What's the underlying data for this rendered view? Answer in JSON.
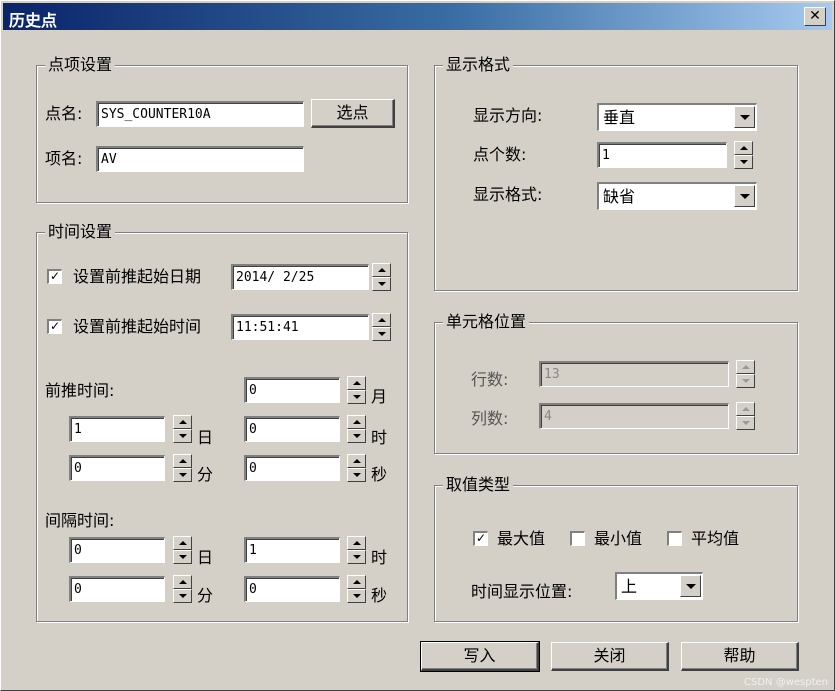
{
  "window": {
    "title": "历史点",
    "close_glyph": "✕"
  },
  "point_settings": {
    "title": "点项设置",
    "point_name_label": "点名:",
    "point_name_value": "SYS_COUNTER10A",
    "select_button": "选点",
    "item_name_label": "项名:",
    "item_name_value": "AV"
  },
  "time_settings": {
    "title": "时间设置",
    "start_date": {
      "checked": true,
      "label": "设置前推起始日期",
      "value": "2014/ 2/25"
    },
    "start_time": {
      "checked": true,
      "label": "设置前推起始时间",
      "value": "11:51:41"
    },
    "lookback": {
      "label": "前推时间:",
      "month": {
        "value": "0",
        "unit": "月"
      },
      "day": {
        "value": "1",
        "unit": "日"
      },
      "hour": {
        "value": "0",
        "unit": "时"
      },
      "minute": {
        "value": "0",
        "unit": "分"
      },
      "second": {
        "value": "0",
        "unit": "秒"
      }
    },
    "interval": {
      "label": "间隔时间:",
      "day": {
        "value": "0",
        "unit": "日"
      },
      "hour": {
        "value": "1",
        "unit": "时"
      },
      "minute": {
        "value": "0",
        "unit": "分"
      },
      "second": {
        "value": "0",
        "unit": "秒"
      }
    }
  },
  "display_format": {
    "title": "显示格式",
    "direction_label": "显示方向:",
    "direction_value": "垂直",
    "count_label": "点个数:",
    "count_value": "1",
    "format_label": "显示格式:",
    "format_value": "缺省"
  },
  "cell_position": {
    "title": "单元格位置",
    "row_label": "行数:",
    "row_value": "13",
    "col_label": "列数:",
    "col_value": "4"
  },
  "value_type": {
    "title": "取值类型",
    "max": {
      "checked": true,
      "label": "最大值"
    },
    "min": {
      "checked": false,
      "label": "最小值"
    },
    "avg": {
      "checked": false,
      "label": "平均值"
    },
    "time_pos_label": "时间显示位置:",
    "time_pos_value": "上"
  },
  "buttons": {
    "write": "写入",
    "close": "关闭",
    "help": "帮助"
  },
  "watermark": "CSDN @wespten"
}
